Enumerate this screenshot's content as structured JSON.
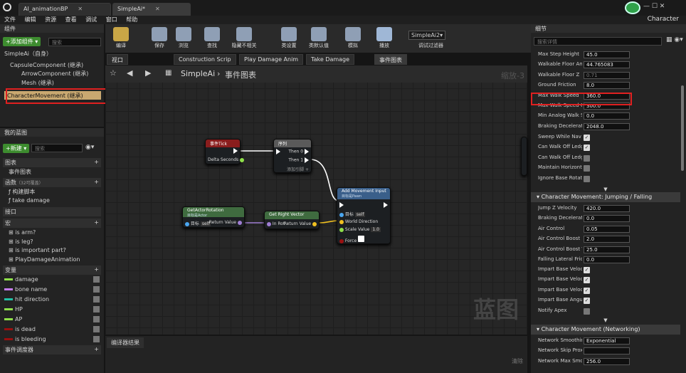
{
  "title_tabs": [
    "AI_animationBP",
    "SimpleAi*"
  ],
  "menu": [
    "文件",
    "编辑",
    "资源",
    "查看",
    "调试",
    "窗口",
    "帮助"
  ],
  "right_title": "Character",
  "components": {
    "header": "组件",
    "add_label": "+添加组件 ▾",
    "search_placeholder": "搜索",
    "items": [
      "SimpleAi（自身）",
      "CapsuleComponent (继承)",
      "ArrowComponent (继承)",
      "Mesh (继承)",
      "CharacterMovement (继承)"
    ]
  },
  "my_blueprint": {
    "header": "我的蓝图",
    "new_label": "+新建 ▾",
    "search_placeholder": "搜索",
    "graphs_label": "图表",
    "event_graph": "事件图表",
    "functions_label": "函数",
    "functions_hint": "（32可覆盖）",
    "functions": [
      "构建脚本",
      "take damage"
    ],
    "interface_label": "接口",
    "macros_label": "宏",
    "macros": [
      "is arm?",
      "is leg?",
      "is important part?",
      "PlayDamageAnimation"
    ],
    "variables_label": "变量",
    "variables": [
      {
        "name": "damage",
        "color": "#8fe04a"
      },
      {
        "name": "bone name",
        "color": "#c67cf0"
      },
      {
        "name": "hit direction",
        "color": "#22c2a6"
      },
      {
        "name": "HP",
        "color": "#8fe04a"
      },
      {
        "name": "AP",
        "color": "#8fe04a"
      },
      {
        "name": "is dead",
        "color": "#9a1010"
      },
      {
        "name": "is bleeding",
        "color": "#9a1010"
      }
    ],
    "dispatchers_label": "事件调度器"
  },
  "toolbar": [
    "编译",
    "保存",
    "浏览",
    "查找",
    "隐藏不相关",
    "类设置",
    "类默认值",
    "模拟",
    "播放"
  ],
  "debug_select": "SimpleAi2▾",
  "debug_label": "调试过滤器",
  "graph_tabs": [
    "视口",
    "Construction Scrip",
    "Play Damage Anim",
    "Take Damage",
    "事件图表"
  ],
  "breadcrumb": {
    "root": "SimpleAi",
    "sep": "›",
    "current": "事件图表"
  },
  "zoom": "缩放-3",
  "watermark": "蓝图",
  "nodes": {
    "tick": {
      "title": "事件Tick",
      "pin": "Delta Seconds"
    },
    "seq": {
      "title": "序列",
      "then0": "Then 0",
      "then1": "Then 1",
      "add": "添加引脚 +"
    },
    "getrot": {
      "title": "GetActorRotation",
      "sub": "目标是Actor",
      "target": "目标",
      "self": "self",
      "ret": "Return Value"
    },
    "getright": {
      "title": "Get Right Vector",
      "inrot": "In Rot",
      "ret": "Return Value"
    },
    "addmove": {
      "title": "Add Movement Input",
      "sub": "目标是Pawn",
      "target": "目标",
      "self": "self",
      "dir": "World Direction",
      "scale": "Scale Value",
      "scale_val": "1.0",
      "force": "Force"
    }
  },
  "compiler": {
    "tab": "编译器结果",
    "clear": "清除"
  },
  "details": {
    "header": "细节",
    "search_placeholder": "搜索详情",
    "rows1": [
      [
        "Max Step Height",
        "45.0"
      ],
      [
        "Walkable Floor Angle",
        "44.765083"
      ],
      [
        "Walkable Floor Z",
        "0.71"
      ],
      [
        "Ground Friction",
        "8.0"
      ],
      [
        "Max Walk Speed",
        "360.0"
      ],
      [
        "Max Walk Speed Cro",
        "300.0"
      ],
      [
        "Min Analog Walk Spe",
        "0.0"
      ],
      [
        "Braking Deceleration",
        "2048.0"
      ]
    ],
    "checks1": [
      "Sweep While Nav Wa",
      "Can Walk Off Ledges",
      "Can Walk Off Ledges",
      "Maintain Horizontal G",
      "Ignore Base Rotation"
    ],
    "section2": "Character Movement: Jumping / Falling",
    "rows2": [
      [
        "Jump Z Velocity",
        "420.0"
      ],
      [
        "Braking Deceleration",
        "0.0"
      ],
      [
        "Air Control",
        "0.05"
      ],
      [
        "Air Control Boost Mul",
        "2.0"
      ],
      [
        "Air Control Boost Vel",
        "25.0"
      ],
      [
        "Falling Lateral Frictio",
        "0.0"
      ]
    ],
    "checks2": [
      "Impart Base Velocity",
      "Impart Base Velocity",
      "Impart Base Velocity",
      "Impart Base Angular",
      "Notify Apex"
    ],
    "section3": "Character Movement (Networking)",
    "rows3": [
      [
        "Network Smoothing I",
        "Exponential"
      ],
      [
        "Network Skip Proxy I",
        ""
      ],
      [
        "Network Max Smooth",
        "256.0"
      ]
    ]
  }
}
